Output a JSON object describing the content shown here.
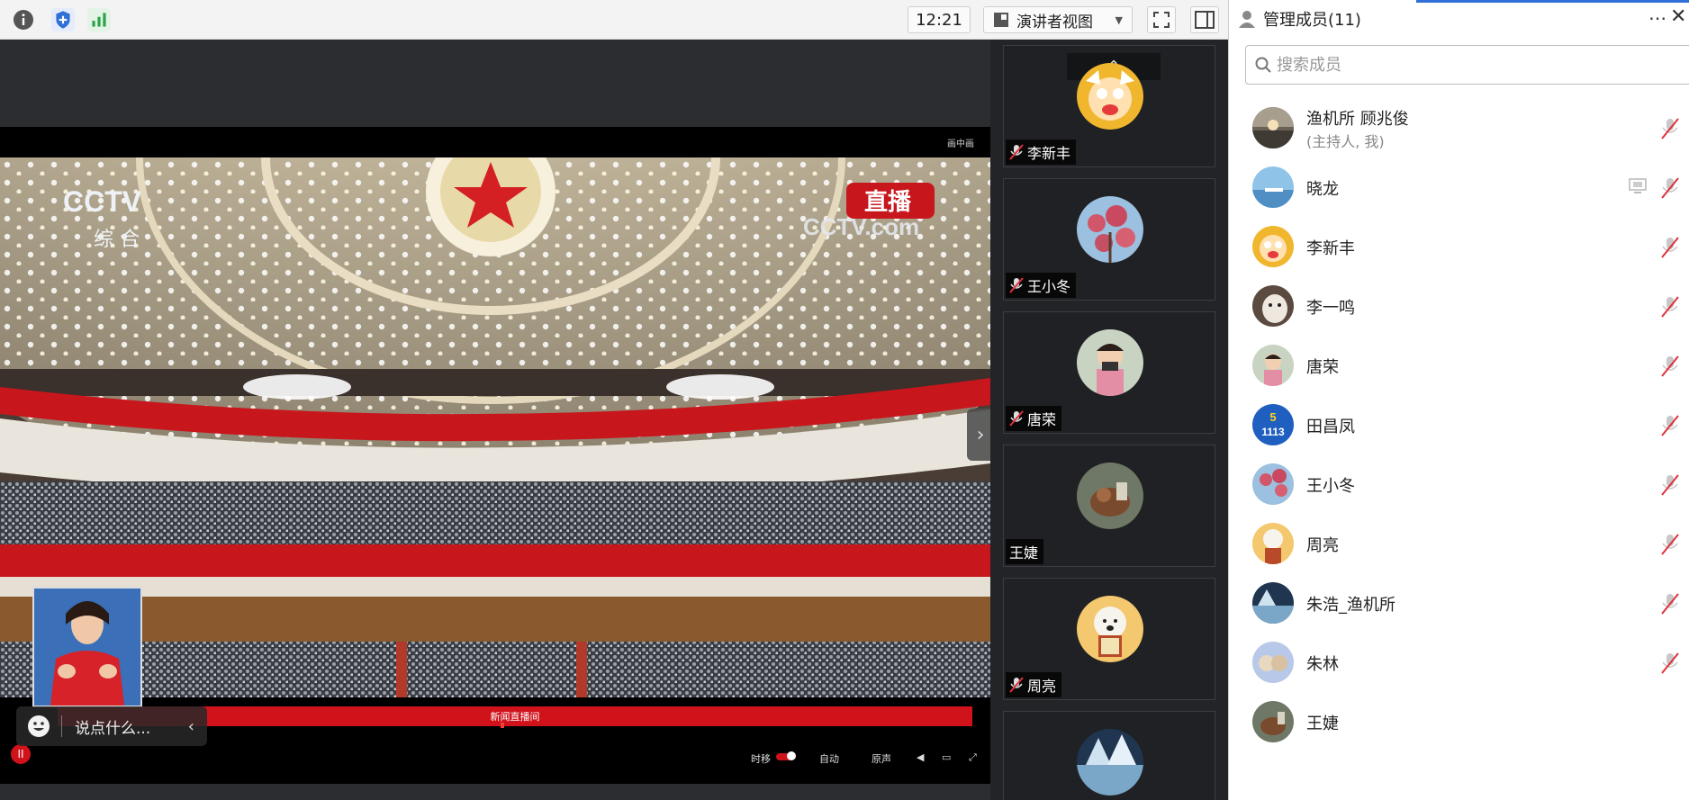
{
  "toolbar": {
    "time": "12:21",
    "view_mode": "演讲者视图"
  },
  "video": {
    "pip_label": "画中画",
    "channel_logo": "CCTV",
    "channel_name": "综 合",
    "live_badge": "直播",
    "site_watermark": "CCTV.com",
    "progress_label": "新闻直播间",
    "controls": {
      "timeshift": "时移",
      "auto": "自动",
      "original": "原声"
    }
  },
  "chat": {
    "placeholder": "说点什么..."
  },
  "thumbnails": [
    {
      "name": "李新丰",
      "muted": true
    },
    {
      "name": "王小冬",
      "muted": true
    },
    {
      "name": "唐荣",
      "muted": true
    },
    {
      "name": "王婕",
      "muted": false
    },
    {
      "name": "周亮",
      "muted": true
    },
    {
      "name": "",
      "muted": false
    }
  ],
  "members_panel": {
    "title": "管理成员(11)",
    "search_placeholder": "搜索成员",
    "members": [
      {
        "name": "渔机所 顾兆俊",
        "sub": "(主持人, 我)",
        "muted": true,
        "sharing": false
      },
      {
        "name": "晓龙",
        "sub": "",
        "muted": true,
        "sharing": true
      },
      {
        "name": "李新丰",
        "sub": "",
        "muted": true,
        "sharing": false
      },
      {
        "name": "李一鸣",
        "sub": "",
        "muted": true,
        "sharing": false
      },
      {
        "name": "唐荣",
        "sub": "",
        "muted": true,
        "sharing": false
      },
      {
        "name": "田昌凤",
        "sub": "",
        "muted": true,
        "sharing": false
      },
      {
        "name": "王小冬",
        "sub": "",
        "muted": true,
        "sharing": false
      },
      {
        "name": "周亮",
        "sub": "",
        "muted": true,
        "sharing": false
      },
      {
        "name": "朱浩_渔机所",
        "sub": "",
        "muted": true,
        "sharing": false
      },
      {
        "name": "朱林",
        "sub": "",
        "muted": true,
        "sharing": false
      },
      {
        "name": "王婕",
        "sub": "",
        "muted": false,
        "sharing": false
      }
    ]
  },
  "avatar_badge": {
    "top": "5",
    "bottom": "1113"
  },
  "colors": {
    "accent": "#2f6fd6",
    "cctv_red": "#d0121b",
    "mute_red": "#e0303a"
  }
}
